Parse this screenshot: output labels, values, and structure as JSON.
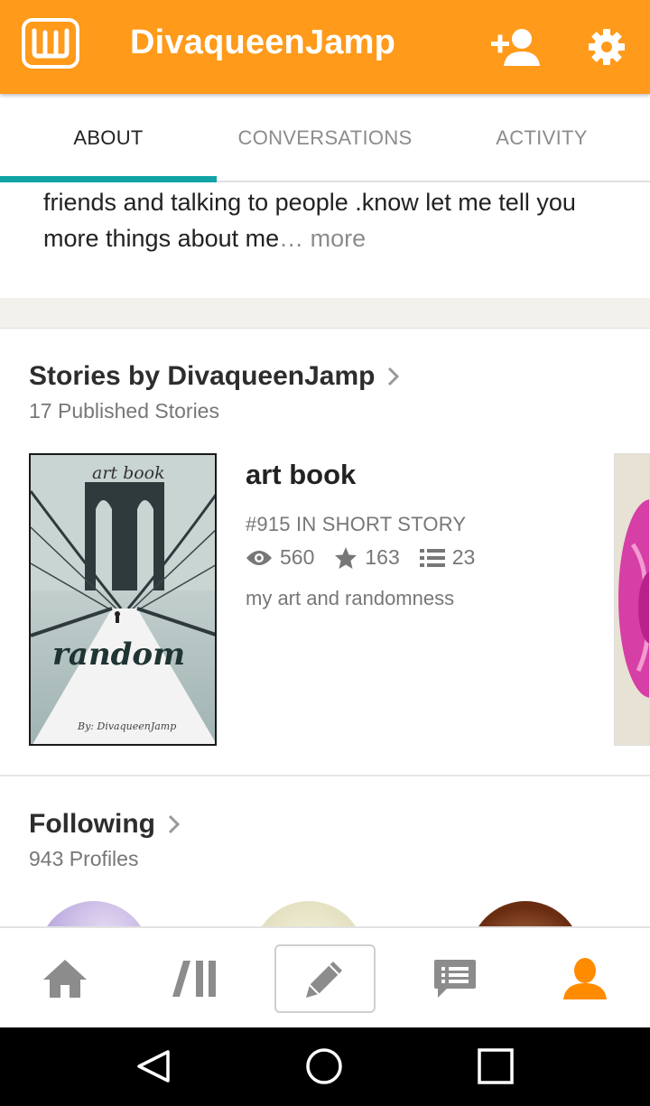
{
  "app_bar": {
    "logo_letter": "W",
    "title": "DivaqueenJamp",
    "icons": [
      "wattpad-logo-icon",
      "follow-user-icon",
      "settings-gear-icon"
    ],
    "color": "#ff9a1a"
  },
  "tabs": {
    "items": [
      {
        "label": "ABOUT",
        "active": true
      },
      {
        "label": "CONVERSATIONS",
        "active": false
      },
      {
        "label": "ACTIVITY",
        "active": false
      }
    ],
    "indicator_color": "#11a3a5"
  },
  "about": {
    "text": "friends and talking to people .know let me tell you more things about me",
    "ellipsis": "…",
    "more_label": "more"
  },
  "stories": {
    "title": "Stories by DivaqueenJamp",
    "subtitle": "17 Published Stories",
    "items": [
      {
        "cover_top_text": "art book",
        "cover_main_text": "random",
        "cover_byline": "By: DivaqueenJamp",
        "title": "art book",
        "rank": "#915 IN SHORT STORY",
        "reads": "560",
        "votes": "163",
        "parts": "23",
        "description": "my art and randomness"
      }
    ]
  },
  "following": {
    "title": "Following",
    "subtitle": "943 Profiles"
  },
  "bottom_nav": {
    "items": [
      "home-icon",
      "library-icon",
      "write-pencil-icon",
      "messages-icon",
      "profile-icon"
    ],
    "active_color": "#ff8c00",
    "inactive_color": "#8c8c8c"
  },
  "system_nav": {
    "items": [
      "back-icon",
      "home-circle-icon",
      "recents-square-icon"
    ]
  }
}
